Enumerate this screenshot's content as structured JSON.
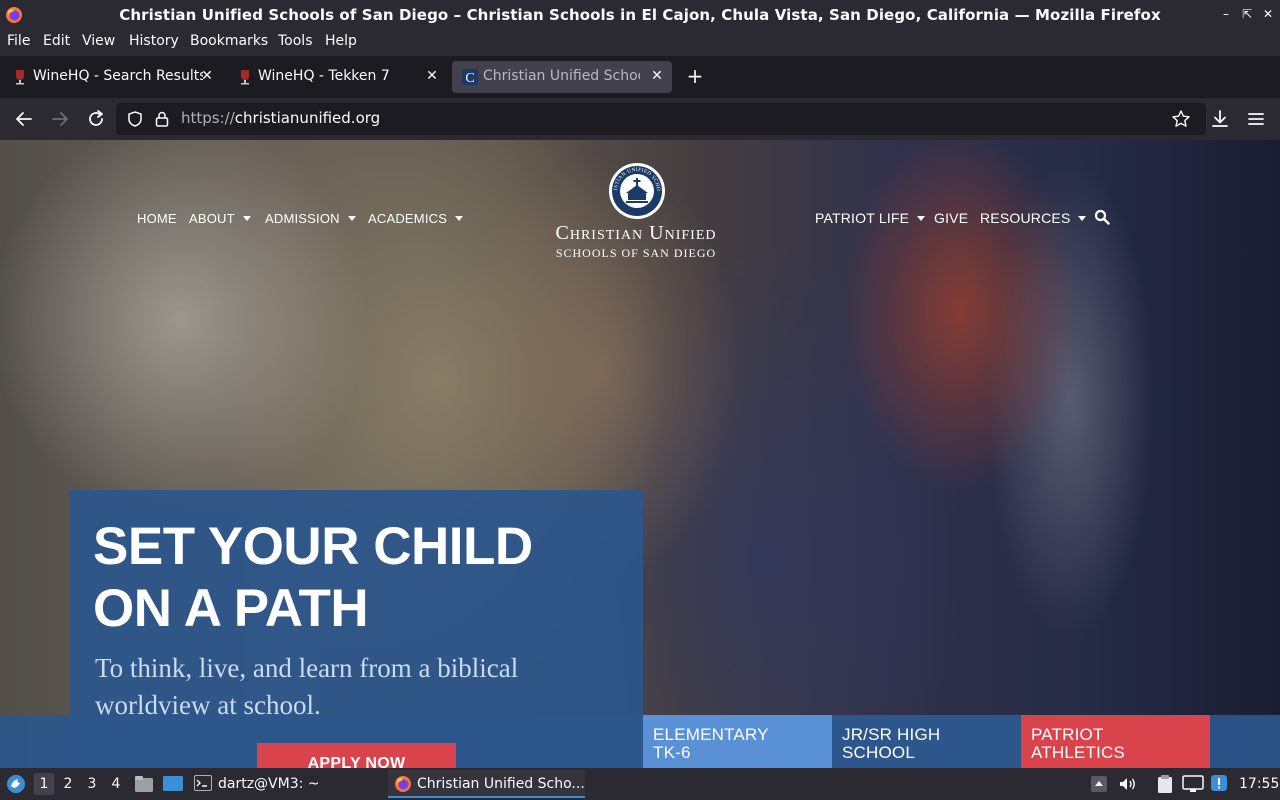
{
  "window": {
    "title": "Christian Unified Schools of San Diego – Christian Schools in El Cajon, Chula Vista, San Diego, California — Mozilla Firefox"
  },
  "menubar": {
    "items": [
      {
        "label": "File"
      },
      {
        "label": "Edit"
      },
      {
        "label": "View"
      },
      {
        "label": "History"
      },
      {
        "label": "Bookmarks"
      },
      {
        "label": "Tools"
      },
      {
        "label": "Help"
      }
    ]
  },
  "tabs": [
    {
      "label": "WineHQ - Search Results",
      "active": false,
      "favicon": "wine-icon"
    },
    {
      "label": "WineHQ - Tekken 7",
      "active": false,
      "favicon": "wine-icon"
    },
    {
      "label": "Christian Unified Schools",
      "active": true,
      "favicon": "cus-favicon"
    }
  ],
  "navbar": {
    "url_protocol": "https://",
    "url_host": "christianunified.org"
  },
  "site": {
    "nav_left": [
      {
        "label": "HOME",
        "dropdown": false
      },
      {
        "label": "ABOUT",
        "dropdown": true
      },
      {
        "label": "ADMISSION",
        "dropdown": true
      },
      {
        "label": "ACADEMICS",
        "dropdown": true
      }
    ],
    "nav_right": [
      {
        "label": "PATRIOT LIFE",
        "dropdown": true
      },
      {
        "label": "GIVE",
        "dropdown": false
      },
      {
        "label": "RESOURCES",
        "dropdown": true
      }
    ],
    "logo_name": "Christian Unified",
    "logo_sub": "SCHOOLS OF SAN DIEGO",
    "logo_seal_text": "CHRISTIAN UNIFIED SCHOOLS",
    "hero_title_line1": "SET YOUR CHILD",
    "hero_title_line2": "ON A PATH",
    "hero_sub": "To think, live, and learn from a biblical worldview at school.",
    "apply_label": "APPLY NOW",
    "tiles": [
      {
        "line1": "ELEMENTARY",
        "line2": "TK-6",
        "color": "#5a91d6"
      },
      {
        "line1": "JR/SR HIGH",
        "line2": "SCHOOL",
        "color": "#2c568c"
      },
      {
        "line1": "PATRIOT",
        "line2": "ATHLETICS",
        "color": "#d9434c"
      }
    ]
  },
  "taskbar": {
    "workspaces": [
      "1",
      "2",
      "3",
      "4"
    ],
    "active_workspace": "1",
    "terminal_task": "dartz@VM3: ~",
    "firefox_task": "Christian Unified Scho...",
    "clock": "17:55"
  },
  "colors": {
    "chrome_dark": "#2b2a33",
    "tab_active": "#42414d",
    "hero_blue": "#2c568c",
    "tile_light_blue": "#5a91d6",
    "accent_red": "#d9434c"
  }
}
